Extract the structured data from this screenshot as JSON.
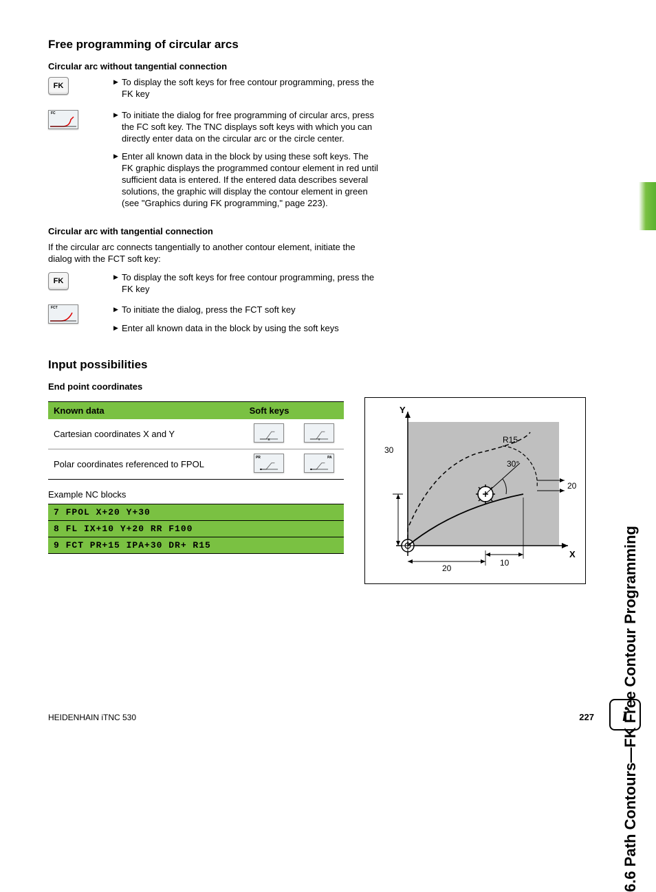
{
  "sideTitle": "6.6 Path Contours—FK Free Contour Programming",
  "section1": {
    "heading": "Free programming of circular arcs",
    "sub1": {
      "heading": "Circular arc without tangential connection",
      "fkLabel": "FK",
      "fcLabel": "FC",
      "items": [
        "To display the soft keys for free contour programming, press the FK key",
        "To initiate the dialog for free programming of circular arcs, press the FC soft key. The TNC displays soft keys with which you can directly enter data on the circular arc or the circle center.",
        "Enter all known data in the block by using these soft keys. The FK graphic displays the programmed contour element in red until sufficient data is entered. If the entered data describes several solutions, the graphic will display the contour element in green (see \"Graphics during FK programming,\" page 223)."
      ]
    },
    "sub2": {
      "heading": "Circular arc with tangential connection",
      "intro": "If the circular arc connects tangentially to another contour element, initiate the dialog with the FCT soft key:",
      "fkLabel": "FK",
      "fctLabel": "FCT",
      "items": [
        "To display the soft keys for free contour programming, press the FK key",
        "To initiate the dialog, press the FCT soft key",
        "Enter all known data in the block by using the soft keys"
      ]
    }
  },
  "section2": {
    "heading": "Input possibilities",
    "sub": "End point coordinates",
    "table": {
      "headers": [
        "Known data",
        "Soft keys"
      ],
      "rows": [
        {
          "label": "Cartesian coordinates X and Y",
          "sk1": "X",
          "sk2": "Y"
        },
        {
          "label": "Polar coordinates referenced to FPOL",
          "sk1": "PR",
          "sk2": "PA"
        }
      ]
    },
    "exampleLabel": "Example NC blocks",
    "nc": [
      "7 FPOL X+20 Y+30",
      "8 FL IX+10 Y+20 RR F100",
      "9 FCT PR+15 IPA+30 DR+ R15"
    ]
  },
  "diagram": {
    "yLabel": "Y",
    "xLabel": "X",
    "v30": "30",
    "v20a": "20",
    "v20b": "20",
    "v10": "10",
    "r15": "R15",
    "ang30": "30°"
  },
  "footer": {
    "left": "HEIDENHAIN iTNC 530",
    "page": "227"
  },
  "infoIcon": "i"
}
